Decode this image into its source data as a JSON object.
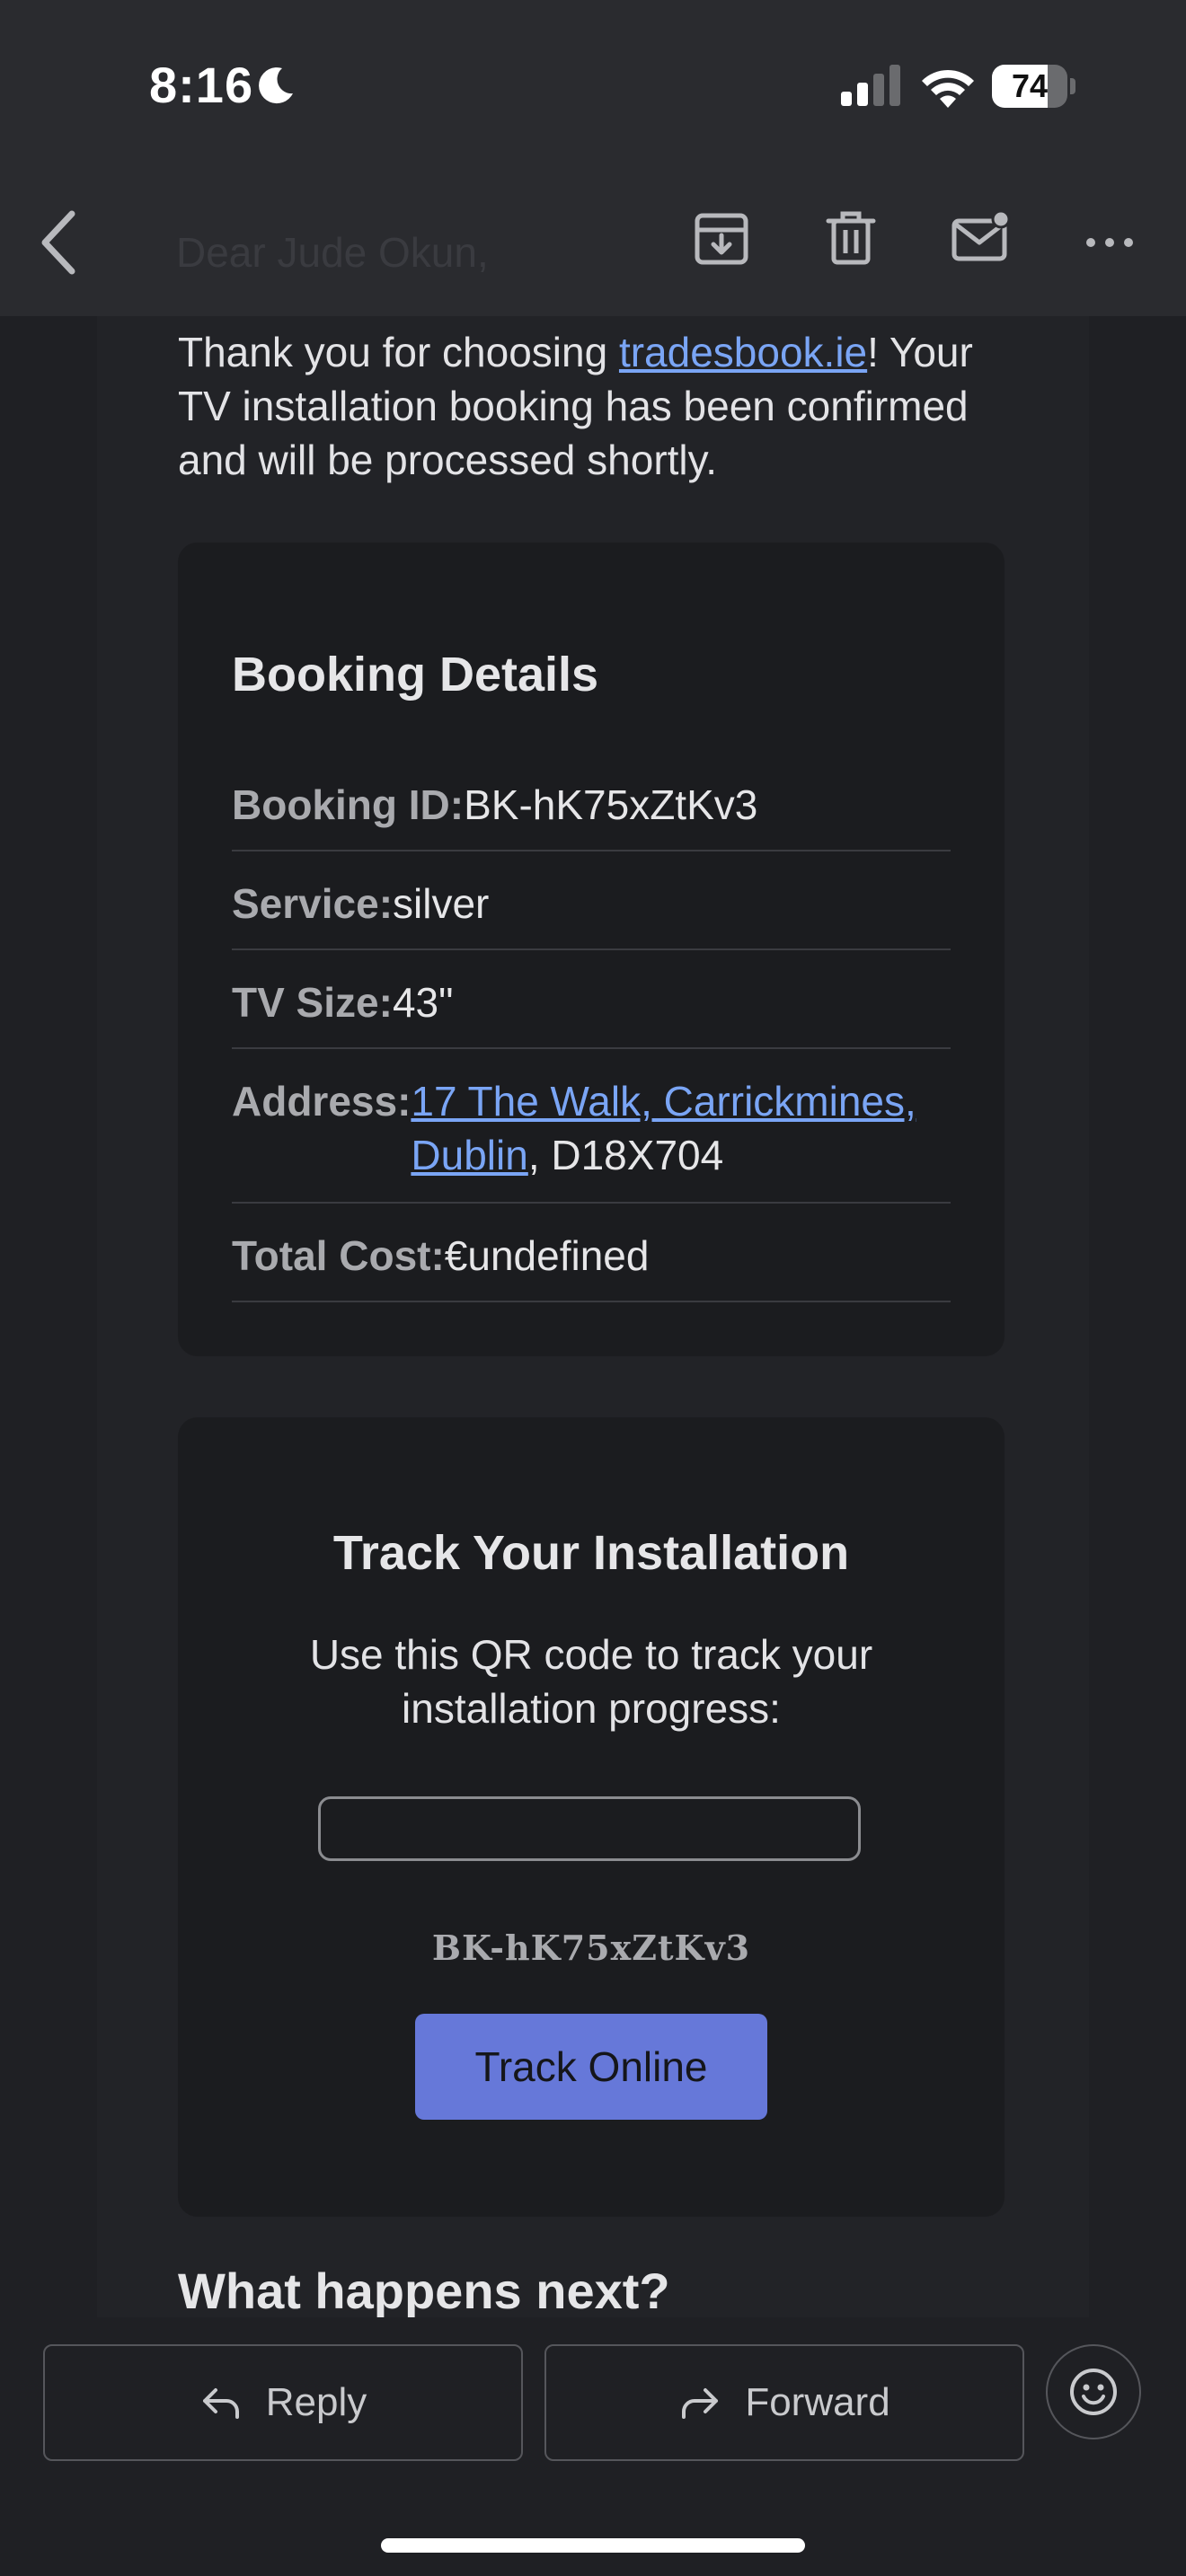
{
  "status_bar": {
    "time": "8:16",
    "battery": "74",
    "battery_level": 0.74
  },
  "toolbar": {
    "subject_preview": "Dear Jude Okun,"
  },
  "email": {
    "intro_prefix": "Thank you for choosing ",
    "intro_link": "tradesbook.ie",
    "intro_suffix": "! Your TV installation booking has been confirmed and will be processed shortly.",
    "booking": {
      "title": "Booking Details",
      "id_label": "Booking ID:",
      "id_value": "BK-hK75xZtKv3",
      "service_label": "Service:",
      "service_value": "silver",
      "tv_size_label": "TV Size:",
      "tv_size_value": "43\"",
      "address_label": "Address:",
      "address_link": "17 The Walk, Carrickmines, Dublin",
      "address_rest": ", D18X704",
      "cost_label": "Total Cost:",
      "cost_value": "€undefined"
    },
    "tracking": {
      "title": "Track Your Installation",
      "description": "Use this QR code to track your installation progress:",
      "code": "BK-hK75xZtKv3",
      "button_label": "Track Online"
    },
    "next_heading": "What happens next?"
  },
  "bottom_bar": {
    "reply_label": "Reply",
    "forward_label": "Forward"
  },
  "colors": {
    "accent_link": "#7aa5f5",
    "button": "#6678d9",
    "background": "#1f2024"
  }
}
